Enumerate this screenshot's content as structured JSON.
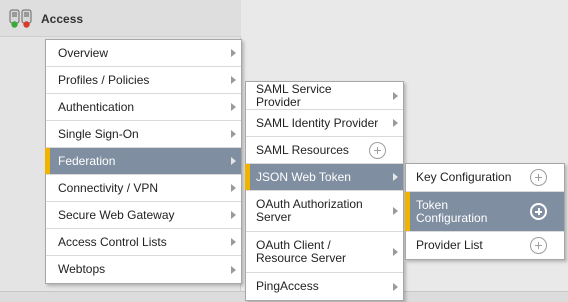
{
  "app": {
    "title": "Access",
    "icon": "access-policy-icon"
  },
  "menu_main": {
    "items": [
      {
        "label": "Overview",
        "has_submenu": true,
        "active": false
      },
      {
        "label": "Profiles / Policies",
        "has_submenu": true,
        "active": false
      },
      {
        "label": "Authentication",
        "has_submenu": true,
        "active": false
      },
      {
        "label": "Single Sign-On",
        "has_submenu": true,
        "active": false
      },
      {
        "label": "Federation",
        "has_submenu": true,
        "active": true
      },
      {
        "label": "Connectivity / VPN",
        "has_submenu": true,
        "active": false
      },
      {
        "label": "Secure Web Gateway",
        "has_submenu": true,
        "active": false
      },
      {
        "label": "Access Control Lists",
        "has_submenu": true,
        "active": false
      },
      {
        "label": "Webtops",
        "has_submenu": true,
        "active": false
      }
    ]
  },
  "menu_federation": {
    "items": [
      {
        "label": "SAML Service Provider",
        "has_submenu": true,
        "has_plus": false,
        "active": false
      },
      {
        "label": "SAML Identity Provider",
        "has_submenu": true,
        "has_plus": false,
        "active": false
      },
      {
        "label": "SAML Resources",
        "has_submenu": false,
        "has_plus": true,
        "active": false
      },
      {
        "label": "JSON Web Token",
        "has_submenu": true,
        "has_plus": false,
        "active": true
      },
      {
        "label": "OAuth Authorization Server",
        "has_submenu": true,
        "has_plus": false,
        "active": false
      },
      {
        "label": "OAuth Client / Resource Server",
        "has_submenu": true,
        "has_plus": false,
        "active": false
      },
      {
        "label": "PingAccess",
        "has_submenu": true,
        "has_plus": false,
        "active": false
      }
    ]
  },
  "menu_jwt": {
    "items": [
      {
        "label": "Key Configuration",
        "has_plus": true,
        "active": false
      },
      {
        "label": "Token Configuration",
        "has_plus": true,
        "active": true
      },
      {
        "label": "Provider List",
        "has_plus": true,
        "active": false
      }
    ]
  },
  "colors": {
    "active_bg": "#7f8ea1",
    "active_marker": "#f0b400"
  }
}
